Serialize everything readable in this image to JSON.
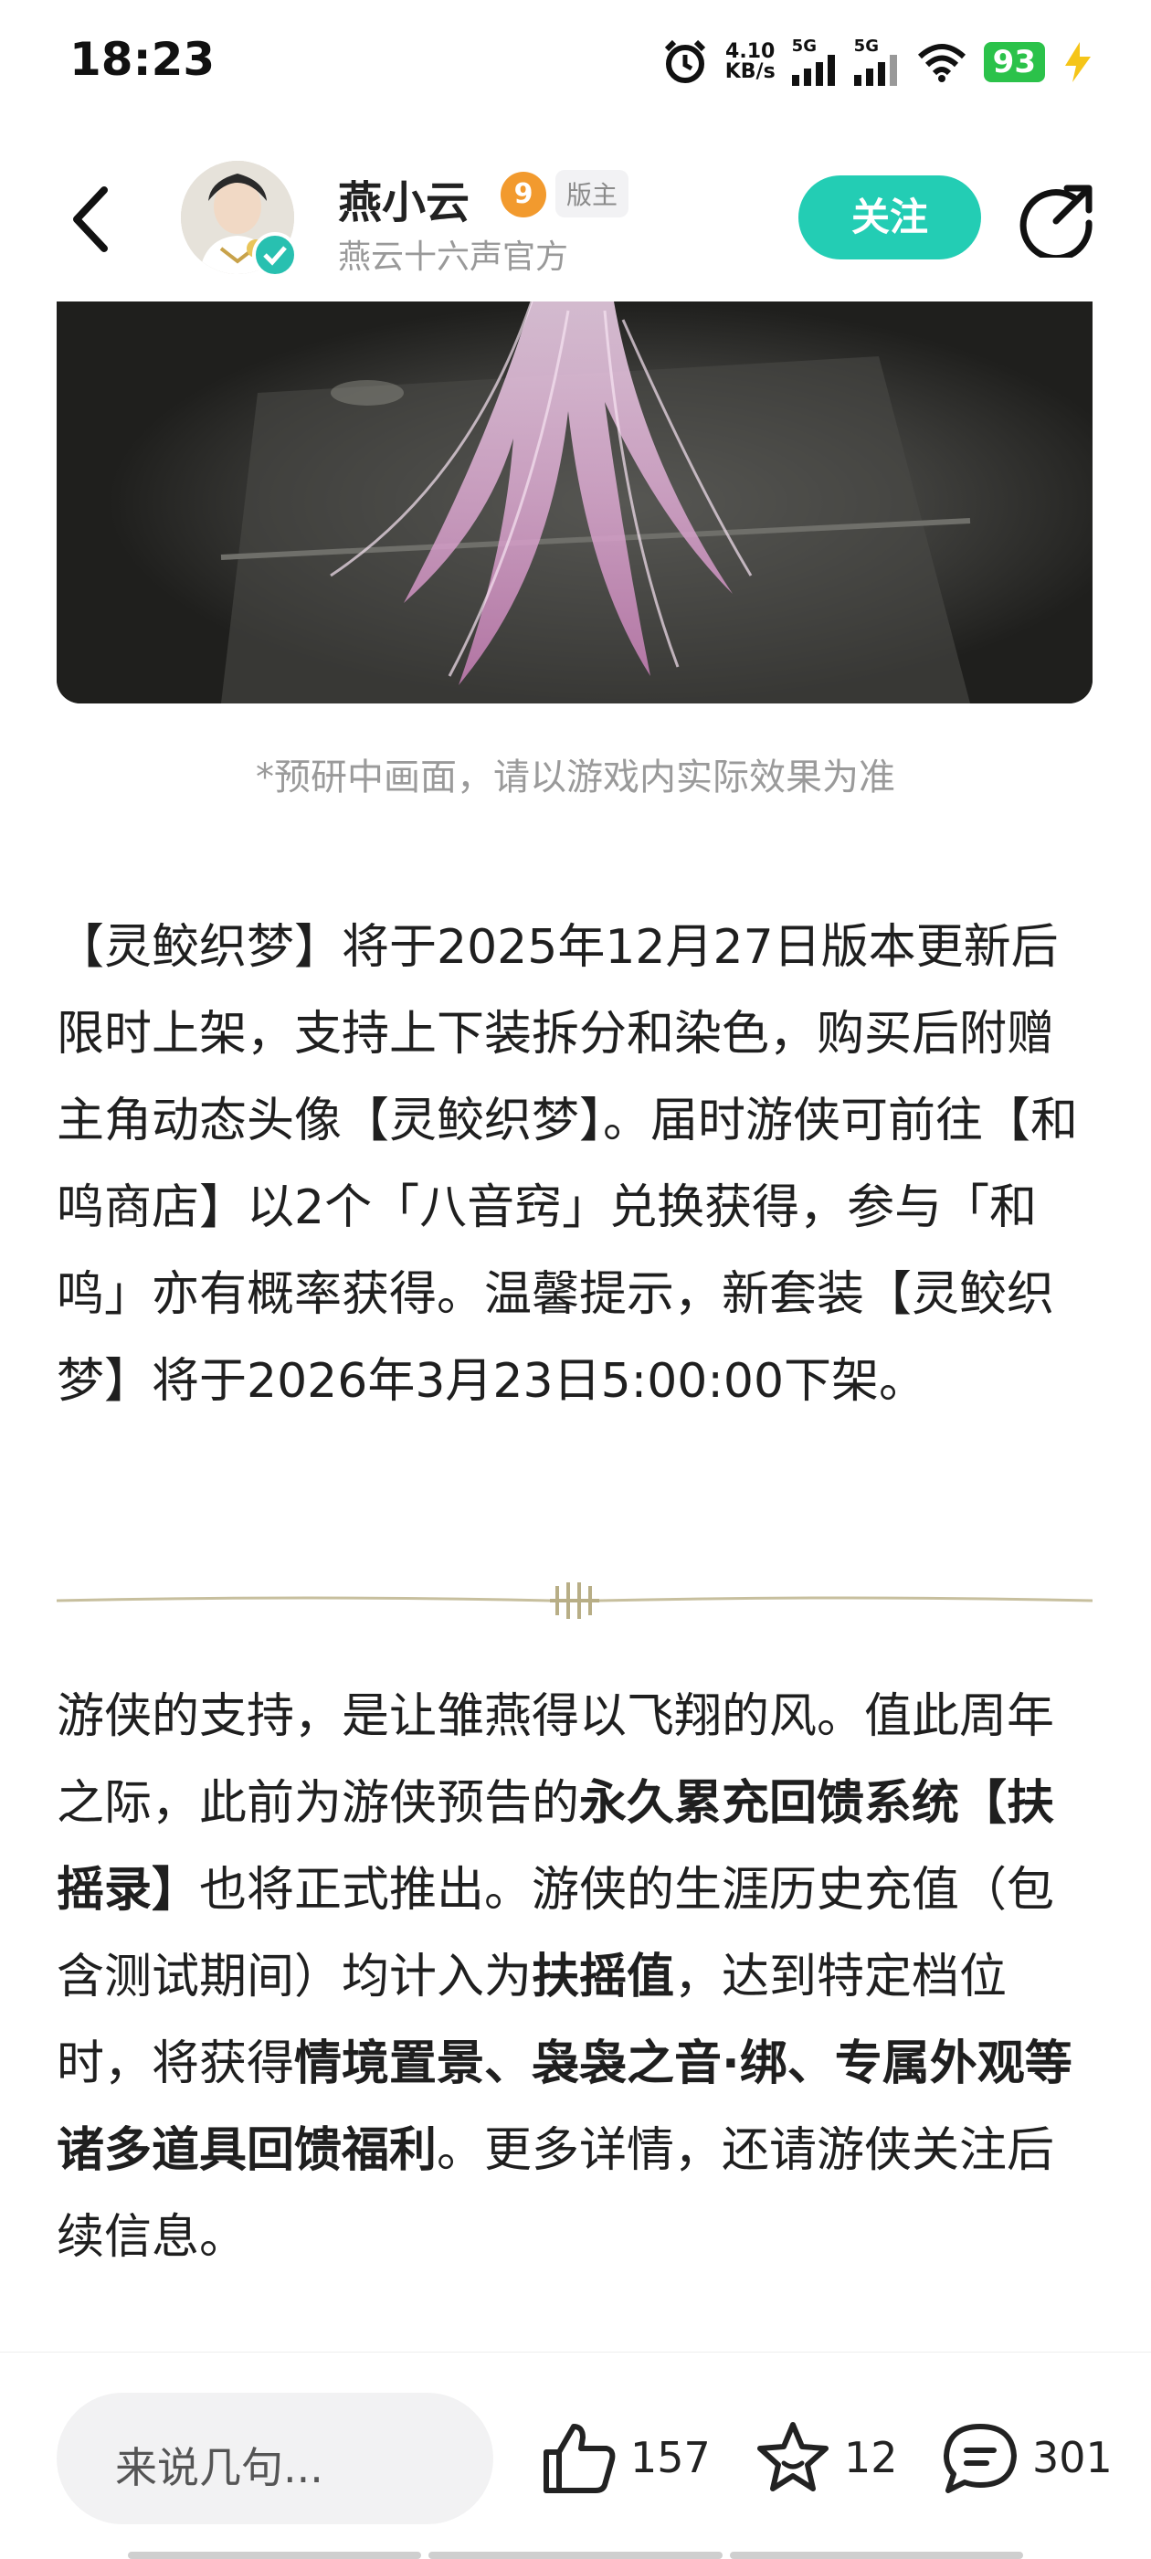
{
  "status_bar": {
    "time": "18:23",
    "net_speed_value": "4.10",
    "net_speed_unit": "KB/s",
    "signal1_label": "5G",
    "signal2_label": "5G",
    "battery": "93",
    "icons": [
      "alarm-icon",
      "signal-icon",
      "wifi-icon",
      "battery-icon",
      "charging-icon"
    ]
  },
  "header": {
    "user_name": "燕小云",
    "level": "9",
    "role_badge": "版主",
    "subtitle": "燕云十六声官方",
    "follow_label": "关注",
    "accent_color": "#23cdb4"
  },
  "post": {
    "image_caption": "*预研中画面，请以游戏内实际效果为准",
    "paragraph1": "【灵鲛织梦】将于2025年12月27日版本更新后限时上架，支持上下装拆分和染色，购买后附赠主角动态头像【灵鲛织梦】。届时游侠可前往【和鸣商店】以2个「八音窍」兑换获得，参与「和鸣」亦有概率获得。温馨提示，新套装【灵鲛织梦】将于2026年3月23日5:00:00下架。",
    "p2_a": "游侠的支持，是让雏燕得以飞翔的风。值此周年之际，此前为游侠预告的",
    "p2_b": "永久累充回馈系统【扶摇录】",
    "p2_c": "也将正式推出。游侠的生涯历史充值（包含测试期间）均计入为",
    "p2_d": "扶摇值",
    "p2_e": "，达到特定档位时，将获得",
    "p2_f": "情境置景、袅袅之音·绑、专属外观等诸多道具回馈福利",
    "p2_g": "。更多详情，还请游侠关注后续信息。"
  },
  "bottom_bar": {
    "comment_placeholder": "来说几句...",
    "like_count": "157",
    "favorite_count": "12",
    "comment_count": "301"
  }
}
